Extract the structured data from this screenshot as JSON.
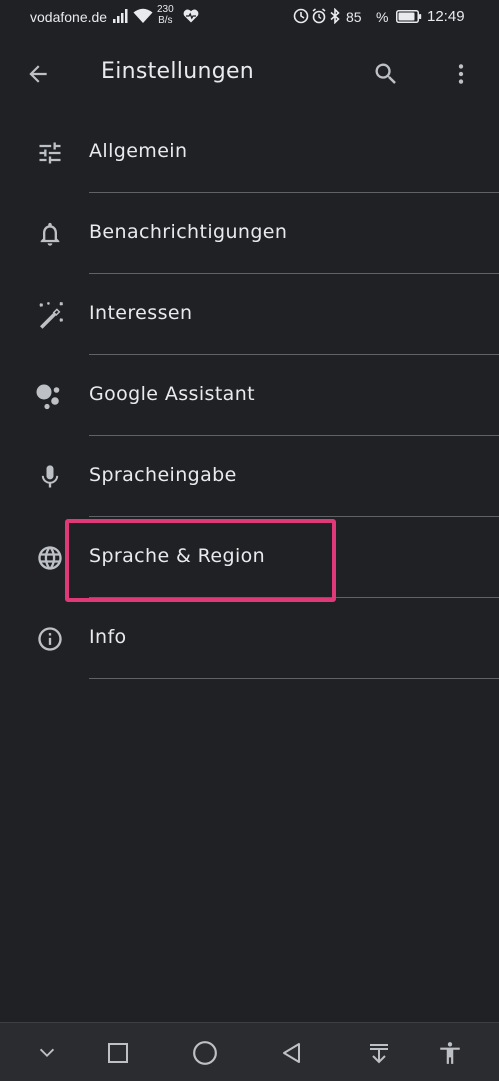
{
  "status_bar": {
    "carrier": "vodafone.de",
    "data_rate_value": "230",
    "data_rate_unit": "B/s",
    "battery_percent": "85",
    "percent_sign": "%",
    "time": "12:49"
  },
  "app_bar": {
    "title": "Einstellungen",
    "back_icon": "arrow-back-icon",
    "search_icon": "search-icon",
    "more_icon": "more-vert-icon"
  },
  "settings": {
    "items": [
      {
        "label": "Allgemein",
        "icon": "tune-icon"
      },
      {
        "label": "Benachrichtigungen",
        "icon": "bell-icon"
      },
      {
        "label": "Interessen",
        "icon": "magic-wand-icon"
      },
      {
        "label": "Google Assistant",
        "icon": "assistant-icon"
      },
      {
        "label": "Spracheingabe",
        "icon": "mic-icon"
      },
      {
        "label": "Sprache & Region",
        "icon": "globe-icon",
        "highlighted": true
      },
      {
        "label": "Info",
        "icon": "info-icon"
      }
    ]
  },
  "colors": {
    "background": "#202124",
    "text": "#e8eaed",
    "icon": "#bdc1c6",
    "divider": "#5f6368",
    "highlight": "#e0397a",
    "nav_bar": "#2b2c2f"
  },
  "nav_bar": {
    "buttons": [
      "chevron-down-icon",
      "square-icon",
      "circle-home-icon",
      "triangle-back-icon",
      "notification-pull-icon",
      "accessibility-icon"
    ]
  }
}
